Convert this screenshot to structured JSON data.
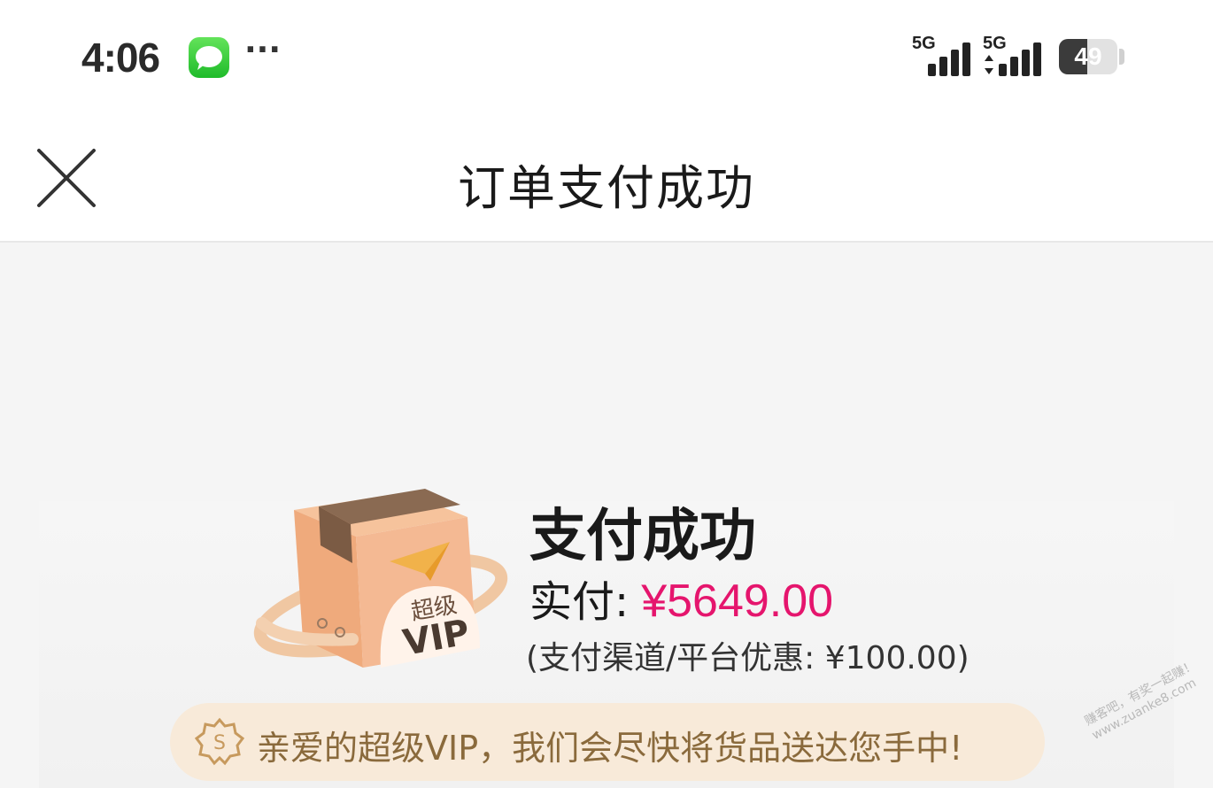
{
  "status_bar": {
    "time": "4:06",
    "more": "···",
    "signals": [
      {
        "label": "5G",
        "level": 4
      },
      {
        "label": "5G",
        "level": 4
      }
    ],
    "battery_percent": "49",
    "icons": [
      "messages-icon",
      "signal-icon",
      "battery-icon"
    ]
  },
  "nav": {
    "title": "订单支付成功",
    "close_icon": "close-icon"
  },
  "result": {
    "title": "支付成功",
    "paid_label": "实付:",
    "paid_amount": "¥5649.00",
    "discount_text": "(支付渠道/平台优惠: ¥100.00)",
    "box_text": "超级",
    "box_vip": "VIP"
  },
  "notice": {
    "text": "亲爱的超级VIP，我们会尽快将货品送达您手中!",
    "icon": "vip-coin-icon"
  },
  "watermark": "赚客吧，有奖一起赚！\nwww.zuanke8.com",
  "colors": {
    "accent_price": "#e5156d",
    "banner_bg": "#f8ead9",
    "banner_text": "#8a6a3c",
    "page_bg": "#f5f5f5"
  }
}
